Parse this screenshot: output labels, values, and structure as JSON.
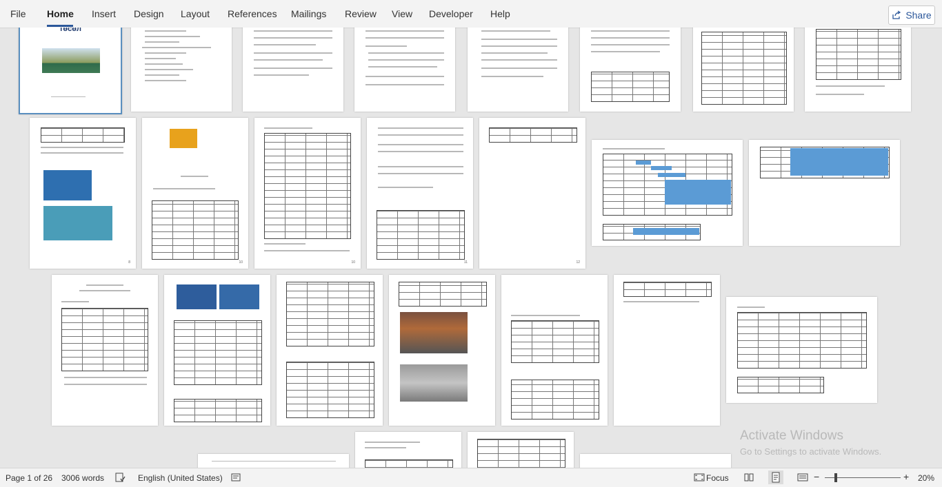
{
  "ribbon": {
    "tabs": [
      {
        "id": "file",
        "label": "File"
      },
      {
        "id": "home",
        "label": "Home"
      },
      {
        "id": "insert",
        "label": "Insert"
      },
      {
        "id": "design",
        "label": "Design"
      },
      {
        "id": "layout",
        "label": "Layout"
      },
      {
        "id": "references",
        "label": "References"
      },
      {
        "id": "mailings",
        "label": "Mailings"
      },
      {
        "id": "review",
        "label": "Review"
      },
      {
        "id": "view",
        "label": "View"
      },
      {
        "id": "developer",
        "label": "Developer"
      },
      {
        "id": "help",
        "label": "Help"
      }
    ],
    "active_tab": "Home",
    "share_label": "Share"
  },
  "document": {
    "cover_title": "төсөл",
    "view_mode": "multi-page"
  },
  "status": {
    "page_info": "Page 1 of 26",
    "word_count": "3006 words",
    "language": "English (United States)",
    "focus_label": "Focus",
    "zoom_label": "20%",
    "zoom_level_percent": 20
  },
  "watermark": {
    "line1": "Activate Windows",
    "line2": "Go to Settings to activate Windows."
  },
  "colors": {
    "accent": "#2b579a",
    "gantt": "#5b9bd5",
    "cover_frame": "#5a8fbf"
  }
}
